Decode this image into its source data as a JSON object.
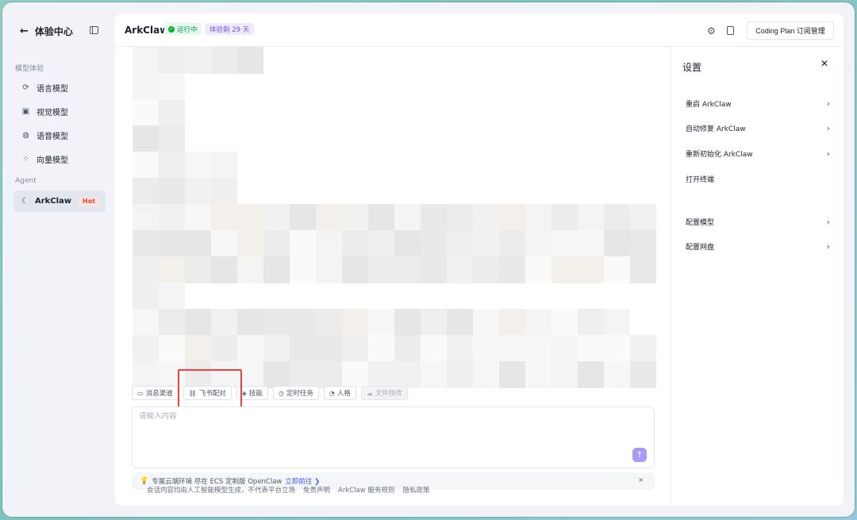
{
  "nav": {
    "back_title": "体验中心",
    "group_models": "模型体验",
    "items": [
      {
        "label": "语言模型",
        "icon": "refresh-icon"
      },
      {
        "label": "视觉模型",
        "icon": "image-icon"
      },
      {
        "label": "语音模型",
        "icon": "globe-icon"
      },
      {
        "label": "向量模型",
        "icon": "vector-icon"
      }
    ],
    "group_agent": "Agent",
    "agent_item": {
      "label": "ArkClaw",
      "badge": "Hot",
      "icon": "claw-icon"
    }
  },
  "header": {
    "title": "ArkClaw",
    "status": "运行中",
    "trial": "体验剩 29 天",
    "coding_plan_button": "Coding Plan 订阅管理"
  },
  "toolbar": [
    {
      "label": "消息渠道",
      "icon": "message-icon",
      "disabled": false
    },
    {
      "label": "飞书配对",
      "icon": "pair-icon",
      "disabled": false
    },
    {
      "label": "技能",
      "icon": "layers-icon",
      "disabled": false
    },
    {
      "label": "定时任务",
      "icon": "clock-icon",
      "disabled": false
    },
    {
      "label": "人格",
      "icon": "persona-icon",
      "disabled": false
    },
    {
      "label": "文件快传",
      "icon": "cloud-icon",
      "disabled": true
    }
  ],
  "input": {
    "placeholder": "请输入内容"
  },
  "promo": {
    "text": "专属云端环境 尽在 ECS 定制版 OpenClaw",
    "link": "立即前往 ❯",
    "close": "×"
  },
  "footer": {
    "disclaimer": "会话内容均由人工智能模型生成，不代表平台立场",
    "links": [
      "免责声明",
      "ArkClaw 服务规则",
      "隐私政策"
    ]
  },
  "settings": {
    "title": "设置",
    "items": [
      {
        "label": "重启 ArkClaw",
        "chevron": true
      },
      {
        "label": "自动修复 ArkClaw",
        "chevron": true
      },
      {
        "label": "重新初始化 ArkClaw",
        "chevron": true
      },
      {
        "label": "打开终端",
        "chevron": false
      },
      {
        "label": "配置模型",
        "chevron": true
      },
      {
        "label": "配置网盘",
        "chevron": true
      }
    ]
  },
  "colors": {
    "accent": "#7a4ff0",
    "highlight": "#f53f3f",
    "running": "#00b42a"
  }
}
